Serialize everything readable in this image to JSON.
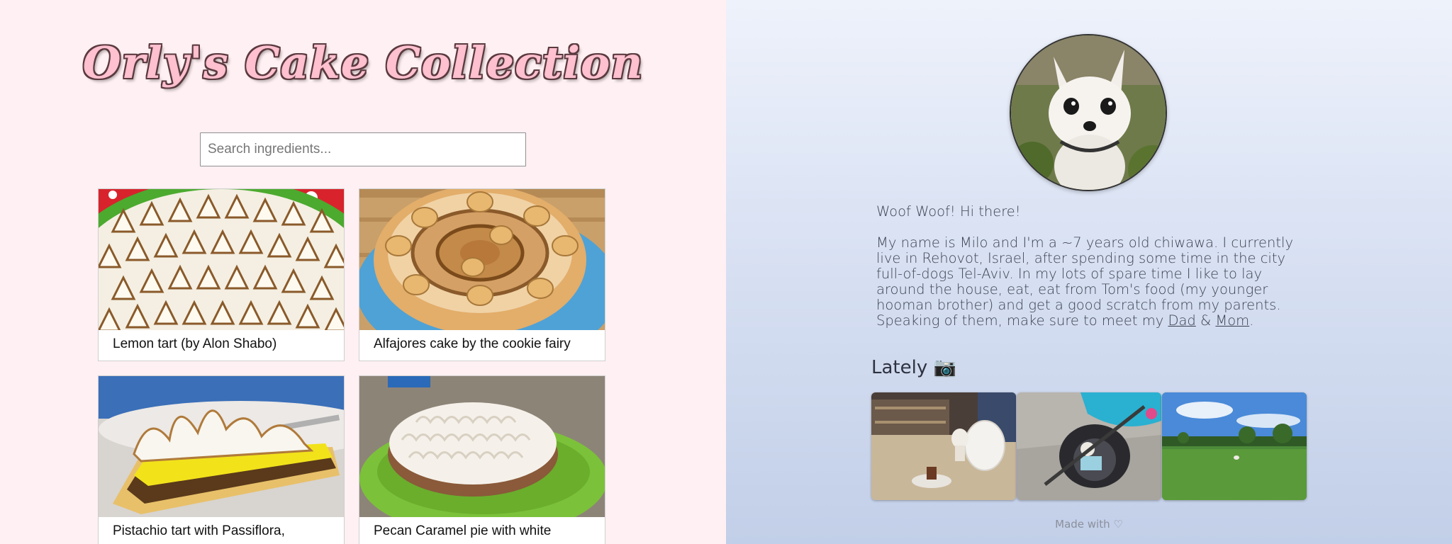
{
  "cake_site": {
    "title": "Orly's Cake Collection",
    "search_placeholder": "Search ingredients...",
    "cakes": [
      {
        "name": "Lemon tart (by Alon Shabo)"
      },
      {
        "name": "Alfajores cake by the cookie fairy"
      },
      {
        "name": "Pistachio tart with Passiflora,"
      },
      {
        "name": "Pecan Caramel pie with white"
      }
    ]
  },
  "profile": {
    "greeting": "Woof Woof! Hi there!",
    "bio_text": "My name is Milo and I'm a ~7 years old chiwawa. I currently live in Rehovot, Israel, after spending some time in the city full-of-dogs Tel-Aviv. In my lots of spare time I like to lay around the house, eat, eat from Tom's food (my younger hooman brother) and get a good scratch from my parents. Speaking of them, make sure to meet my ",
    "dad_link": "Dad",
    "amp": " & ",
    "mom_link": "Mom",
    "period": ".",
    "lately_heading": "Lately 📷",
    "footer": "Made with ♡"
  },
  "colors": {
    "left_bg": "#fff0f3",
    "title_fill": "#ffc0cf",
    "title_outline": "#5a3a3f",
    "right_bg_top": "#eef2fb",
    "right_bg_bottom": "#c2cfe8"
  }
}
